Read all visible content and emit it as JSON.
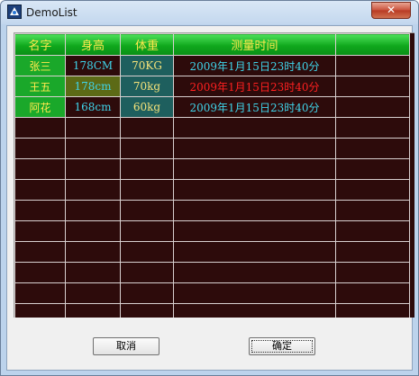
{
  "window": {
    "title": "DemoList",
    "close_label": "✕"
  },
  "list": {
    "columns": [
      "名字",
      "身高",
      "体重",
      "测量时间",
      ""
    ],
    "rows": [
      {
        "name": "张三",
        "height": "178CM",
        "weight": "70KG",
        "time": "2009年1月15日23时40分"
      },
      {
        "name": "王五",
        "height": "178cm",
        "weight": "70kg",
        "time": "2009年1月15日23时40分"
      },
      {
        "name": "阿花",
        "height": "168cm",
        "weight": "60kg",
        "time": "2009年1月15日23时40分"
      }
    ]
  },
  "buttons": {
    "cancel": "取消",
    "ok": "确定"
  },
  "colors": {
    "list_background": "#2d0b0b",
    "header_green": "#0fa81c",
    "header_text": "#ffe94d",
    "cyan_text": "#3fd4ea",
    "red_text": "#ff2020"
  },
  "icons": {
    "app": "app-icon",
    "close": "close-icon"
  }
}
